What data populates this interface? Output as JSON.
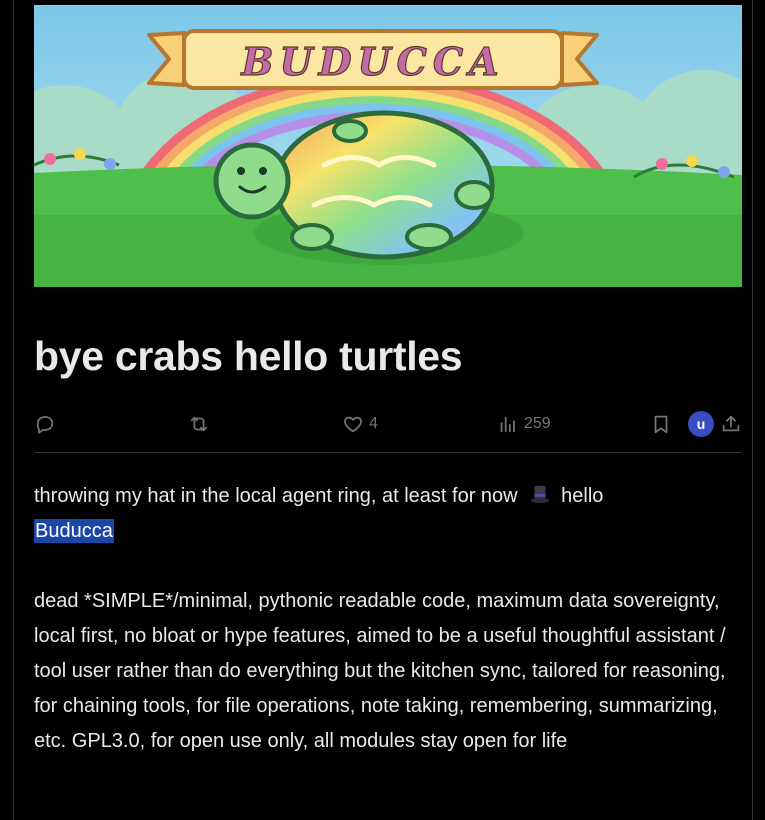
{
  "hero": {
    "banner_text": "BUDUCCA",
    "colors": {
      "sky": "#87cde8",
      "grass": "#4fbf4b",
      "banner": "#fbe6a2",
      "turtle": "#8edc8c"
    }
  },
  "post": {
    "title": "bye crabs hello turtles",
    "paragraph1_before": "throwing my hat in the local agent ring, at least for now",
    "paragraph1_emoji": "top-hat-emoji",
    "paragraph1_after": "hello",
    "paragraph1_highlight": "Buducca",
    "paragraph2": "dead *SIMPLE*/minimal, pythonic readable code, maximum data sovereignty, local first, no bloat or hype features, aimed to be a useful thoughtful assistant / tool user rather than do everything but the kitchen sync, tailored for reasoning, for chaining tools, for file operations, note taking, remembering, summarizing, etc. GPL3.0, for open use only, all modules stay open for life"
  },
  "actions": {
    "reply_icon": "reply-icon",
    "repost_icon": "repost-icon",
    "like_icon": "heart-icon",
    "like_count": "4",
    "views_icon": "views-icon",
    "views_count": "259",
    "bookmark_icon": "bookmark-icon",
    "avatar_letter": "u",
    "share_icon": "share-icon",
    "avatar_color": "#3a4cc0"
  }
}
